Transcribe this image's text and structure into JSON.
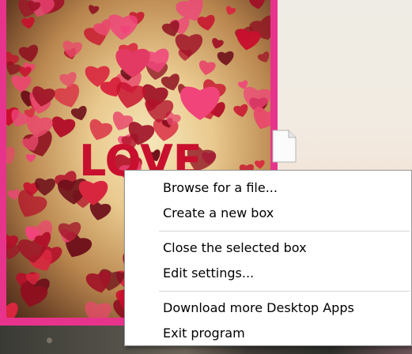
{
  "box": {
    "frame_color": "#e8338c",
    "image_text": "LOVE"
  },
  "file_icon": "document-icon",
  "context_menu": {
    "groups": [
      {
        "items": [
          {
            "label": "Browse for a file..."
          },
          {
            "label": "Create a new box"
          }
        ]
      },
      {
        "items": [
          {
            "label": "Close the selected box"
          },
          {
            "label": "Edit settings..."
          }
        ]
      },
      {
        "items": [
          {
            "label": "Download more Desktop Apps"
          },
          {
            "label": "Exit program"
          }
        ]
      }
    ]
  },
  "colors": {
    "menu_background": "#ffffff",
    "menu_border": "#979797",
    "separator": "#d7d7d7",
    "accent_pink": "#e8338c",
    "heart_red": "#d0203a",
    "heart_pink": "#f0447a"
  }
}
